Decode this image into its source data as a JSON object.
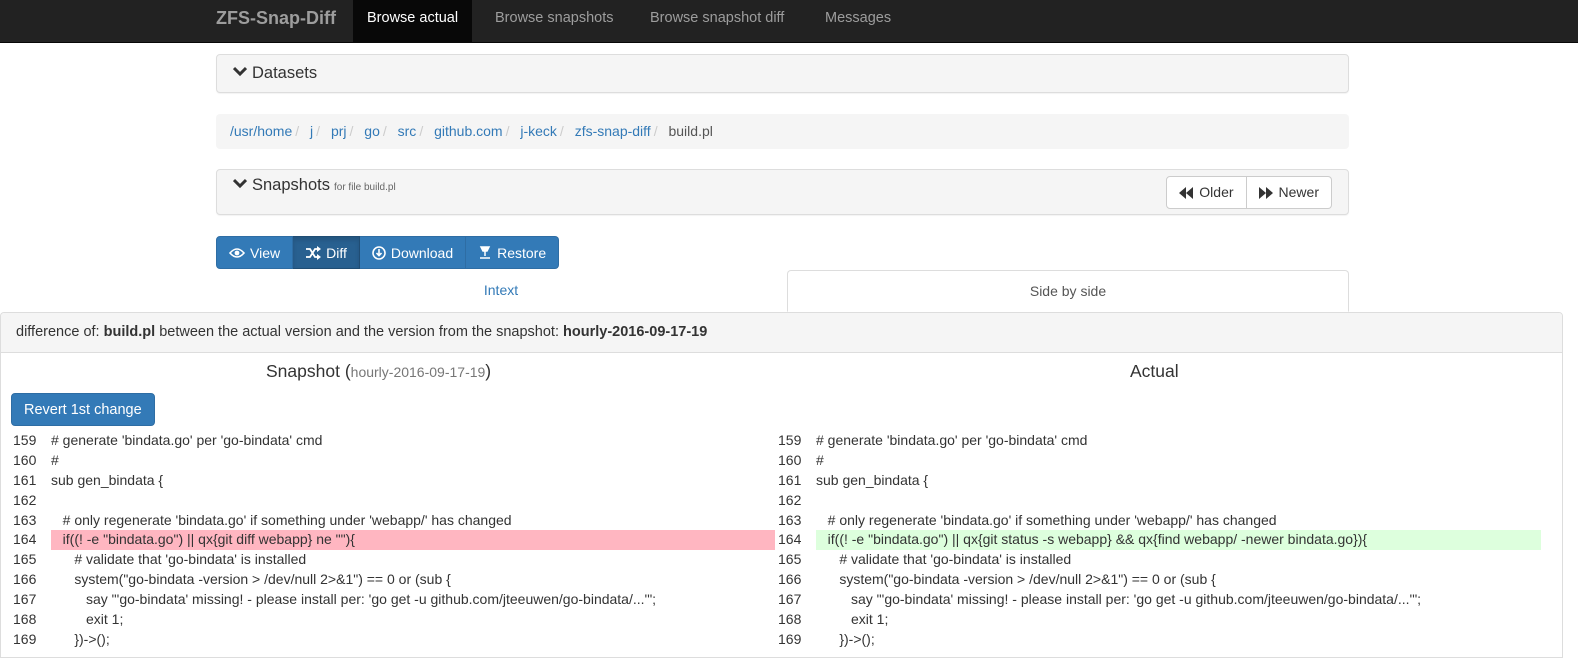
{
  "navbar": {
    "brand": "ZFS-Snap-Diff",
    "items": [
      {
        "label": "Browse actual",
        "active": true
      },
      {
        "label": "Browse snapshots",
        "active": false
      },
      {
        "label": "Browse snapshot diff",
        "active": false
      },
      {
        "label": "Messages",
        "active": false
      }
    ]
  },
  "datasets": {
    "title": "Datasets",
    "icon": "chevron-down-icon"
  },
  "breadcrumb": {
    "items": [
      "/usr/home",
      "j",
      "prj",
      "go",
      "src",
      "github.com",
      "j-keck",
      "zfs-snap-diff"
    ],
    "current": "build.pl",
    "separator": "/"
  },
  "snapshots": {
    "title": "Snapshots",
    "subtitle": "for file build.pl",
    "older_label": "Older",
    "newer_label": "Newer"
  },
  "actions": {
    "view_label": "View",
    "diff_label": "Diff",
    "download_label": "Download",
    "restore_label": "Restore",
    "active": "Diff"
  },
  "tabs": {
    "intext_label": "Intext",
    "side_by_side_label": "Side by side",
    "active": "Side by side"
  },
  "diff": {
    "heading_prefix": "difference of:",
    "file": "build.pl",
    "heading_middle": "between the actual version and the version from the snapshot:",
    "snapshot": "hourly-2016-09-17-19",
    "left_title": "Snapshot",
    "left_paren_open": "(",
    "left_paren_close": ")",
    "right_title": "Actual",
    "revert_label": "Revert 1st change",
    "colors": {
      "removed": "#ffb6c1",
      "added": "#ddffdd",
      "primary": "#337ab7"
    },
    "left_lines": [
      {
        "num": "159",
        "text": "# generate 'bindata.go' per 'go-bindata' cmd",
        "type": "same"
      },
      {
        "num": "160",
        "text": "#",
        "type": "same"
      },
      {
        "num": "161",
        "text": "sub gen_bindata {",
        "type": "same"
      },
      {
        "num": "162",
        "text": "",
        "type": "same"
      },
      {
        "num": "163",
        "text": "   # only regenerate 'bindata.go' if something under 'webapp/' has changed",
        "type": "same"
      },
      {
        "num": "164",
        "text": "   if((! -e \"bindata.go\") || qx{git diff webapp} ne \"\"){",
        "type": "removed"
      },
      {
        "num": "165",
        "text": "      # validate that 'go-bindata' is installed",
        "type": "same"
      },
      {
        "num": "166",
        "text": "      system(\"go-bindata -version > /dev/null 2>&1\") == 0 or (sub {",
        "type": "same"
      },
      {
        "num": "167",
        "text": "         say \"'go-bindata' missing! - please install per: 'go get -u github.com/jteeuwen/go-bindata/...'\";",
        "type": "same"
      },
      {
        "num": "168",
        "text": "         exit 1;",
        "type": "same"
      },
      {
        "num": "169",
        "text": "      })->();",
        "type": "same"
      }
    ],
    "right_lines": [
      {
        "num": "159",
        "text": "# generate 'bindata.go' per 'go-bindata' cmd",
        "type": "same"
      },
      {
        "num": "160",
        "text": "#",
        "type": "same"
      },
      {
        "num": "161",
        "text": "sub gen_bindata {",
        "type": "same"
      },
      {
        "num": "162",
        "text": "",
        "type": "same"
      },
      {
        "num": "163",
        "text": "   # only regenerate 'bindata.go' if something under 'webapp/' has changed",
        "type": "same"
      },
      {
        "num": "164",
        "text": "   if((! -e \"bindata.go\") || qx{git status -s webapp} && qx{find webapp/ -newer bindata.go}){",
        "type": "added"
      },
      {
        "num": "165",
        "text": "      # validate that 'go-bindata' is installed",
        "type": "same"
      },
      {
        "num": "166",
        "text": "      system(\"go-bindata -version > /dev/null 2>&1\") == 0 or (sub {",
        "type": "same"
      },
      {
        "num": "167",
        "text": "         say \"'go-bindata' missing! - please install per: 'go get -u github.com/jteeuwen/go-bindata/...'\";",
        "type": "same"
      },
      {
        "num": "168",
        "text": "         exit 1;",
        "type": "same"
      },
      {
        "num": "169",
        "text": "      })->();",
        "type": "same"
      }
    ]
  }
}
